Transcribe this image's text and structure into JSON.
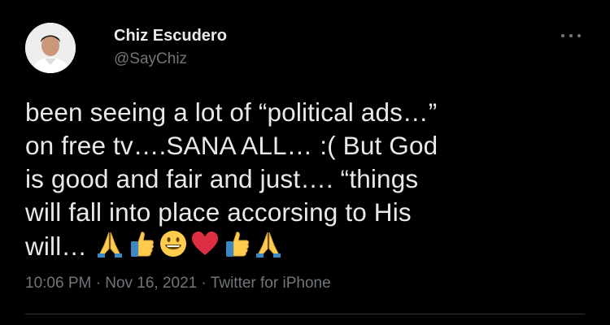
{
  "author": {
    "name": "Chiz Escudero",
    "handle": "@SayChiz"
  },
  "tweet": {
    "lines": [
      "been seeing a lot of “political ads…”",
      "on free tv….SANA ALL… :( But God",
      "is good and fair and just…. “things",
      "will fall into place accorsing to His",
      "will…"
    ],
    "emojis": [
      "folded-hands",
      "thumbs-up",
      "grinning-face",
      "red-heart",
      "thumbs-up",
      "folded-hands"
    ]
  },
  "meta": {
    "time": "10:06 PM",
    "separator": "·",
    "date": "Nov 16, 2021",
    "source": "Twitter for iPhone"
  },
  "icons": {
    "more": "more-horizontal-icon"
  },
  "colors": {
    "background": "#000000",
    "primary_text": "#e7e9ea",
    "secondary_text": "#71767b",
    "divider": "#2f3336"
  }
}
